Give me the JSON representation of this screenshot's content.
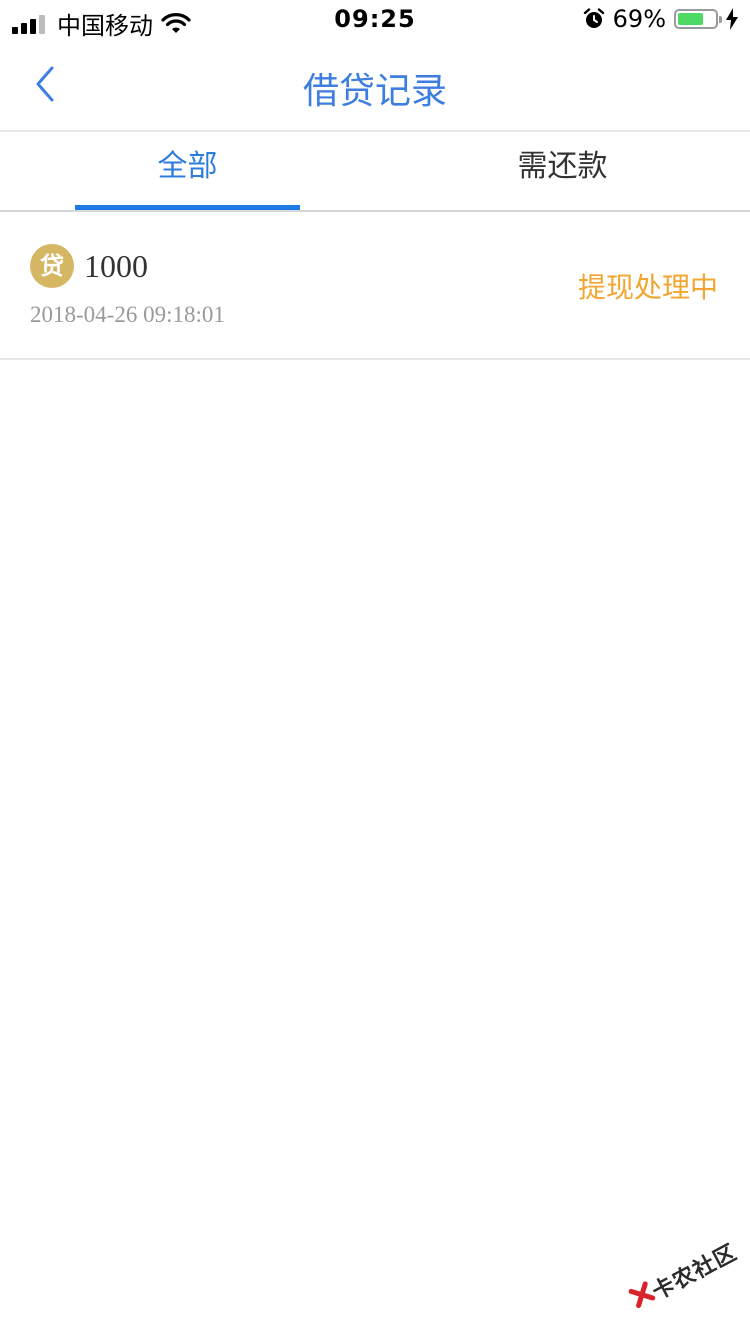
{
  "status_bar": {
    "carrier": "中国移动",
    "time": "09:25",
    "battery_percent": "69%",
    "battery_level": 0.69,
    "battery_color": "#4cd964"
  },
  "nav": {
    "title": "借贷记录",
    "back_icon": "chevron-left-icon",
    "accent_color": "#3d7ee0"
  },
  "tabs": [
    {
      "label": "全部",
      "active": true
    },
    {
      "label": "需还款",
      "active": false
    }
  ],
  "loans": [
    {
      "badge": "贷",
      "amount": "1000",
      "time": "2018-04-26 09:18:01",
      "status": "提现处理中",
      "status_color": "#f1a630"
    }
  ],
  "watermark": {
    "text": "卡农社区"
  }
}
